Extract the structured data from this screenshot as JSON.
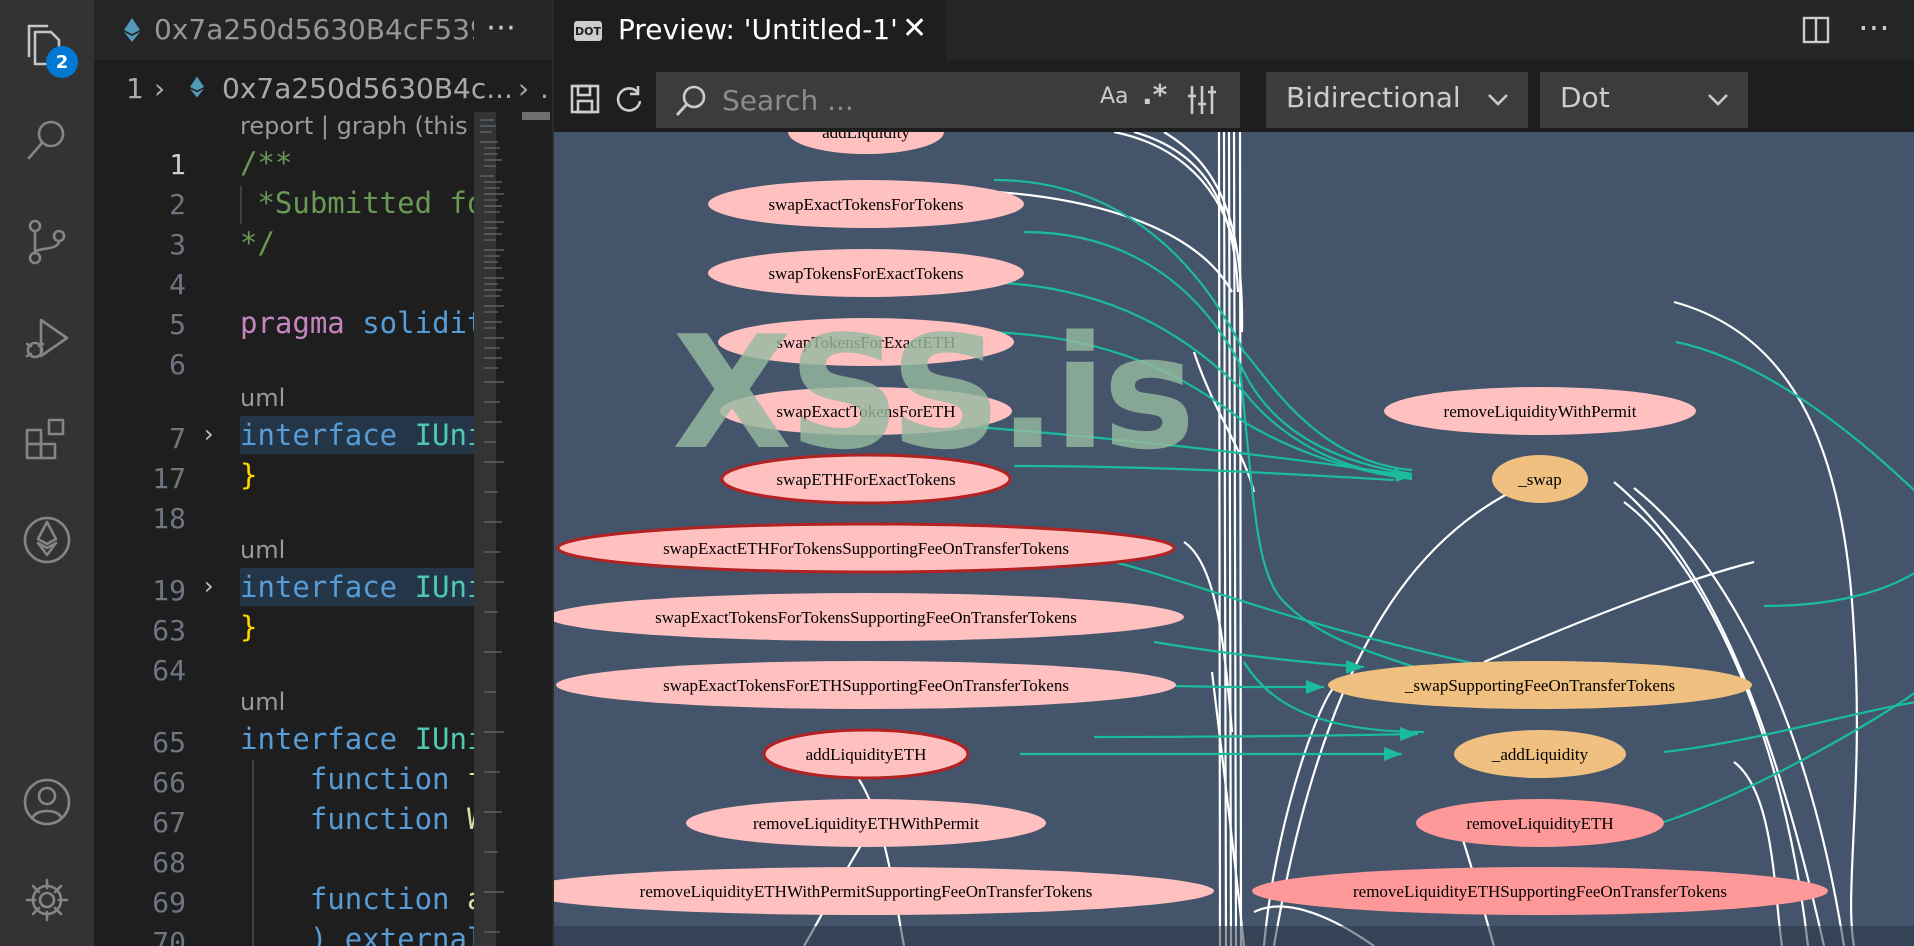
{
  "activity_bar": {
    "explorer_badge": "2"
  },
  "editor": {
    "tab_title": "0x7a250d5630B4cF539",
    "breadcrumb": {
      "index": "1",
      "file": "0x7a250d5630B4c...",
      "more": "."
    },
    "codelens_top": "report | graph (this",
    "lines": [
      {
        "num": "1",
        "text": "/**"
      },
      {
        "num": "2",
        "text": " *Submitted fo"
      },
      {
        "num": "3",
        "text": "*/"
      },
      {
        "num": "4",
        "text": ""
      },
      {
        "num": "5",
        "kw": "pragma",
        "text": " solidit"
      },
      {
        "num": "6",
        "text": ""
      },
      {
        "num": "7",
        "kw": "interface",
        "text": " IUni"
      },
      {
        "num": "17",
        "text": "}"
      },
      {
        "num": "18",
        "text": ""
      },
      {
        "num": "19",
        "kw": "interface",
        "text": " IUni"
      },
      {
        "num": "63",
        "text": "}"
      },
      {
        "num": "64",
        "text": ""
      },
      {
        "num": "65",
        "kw": "interface",
        "text": " IUni"
      },
      {
        "num": "66",
        "kw": "    function",
        "text": " f"
      },
      {
        "num": "67",
        "kw": "    function",
        "text": " W"
      },
      {
        "num": "68",
        "text": ""
      },
      {
        "num": "69",
        "kw": "    function",
        "text": " a"
      },
      {
        "num": "70",
        "text": "    ) external"
      }
    ],
    "lens": [
      "uml",
      "uml",
      "uml"
    ]
  },
  "preview": {
    "tab_icon": "DOT",
    "tab_title": "Preview: 'Untitled-1'",
    "search_placeholder": "Search ...",
    "case_label": "Aa",
    "regex_label": ".*",
    "direction": "Bidirectional",
    "engine": "Dot",
    "watermark": "XSS.is",
    "left_nodes": [
      "addLiquidity",
      "swapExactTokensForTokens",
      "swapTokensForExactTokens",
      "swapTokensForExactETH",
      "swapExactTokensForETH",
      "swapETHForExactTokens",
      "swapExactETHForTokensSupportingFeeOnTransferTokens",
      "swapExactTokensForTokensSupportingFeeOnTransferTokens",
      "swapExactTokensForETHSupportingFeeOnTransferTokens",
      "addLiquidityETH",
      "removeLiquidityETHWithPermit",
      "removeLiquidityETHWithPermitSupportingFeeOnTransferTokens"
    ],
    "right_nodes": [
      "removeLiquidityWithPermit",
      "_swap",
      "_swapSupportingFeeOnTransferTokens",
      "_addLiquidity",
      "removeLiquidityETH",
      "removeLiquidityETHSupportingFeeOnTransferTokens"
    ],
    "colors": {
      "node_pink": "#ffc0c0",
      "node_orange": "#f0c080",
      "node_red": "#ff9999",
      "edge_teal": "#1abc9c",
      "border_red": "#b22222",
      "bg": "#43546b"
    }
  }
}
